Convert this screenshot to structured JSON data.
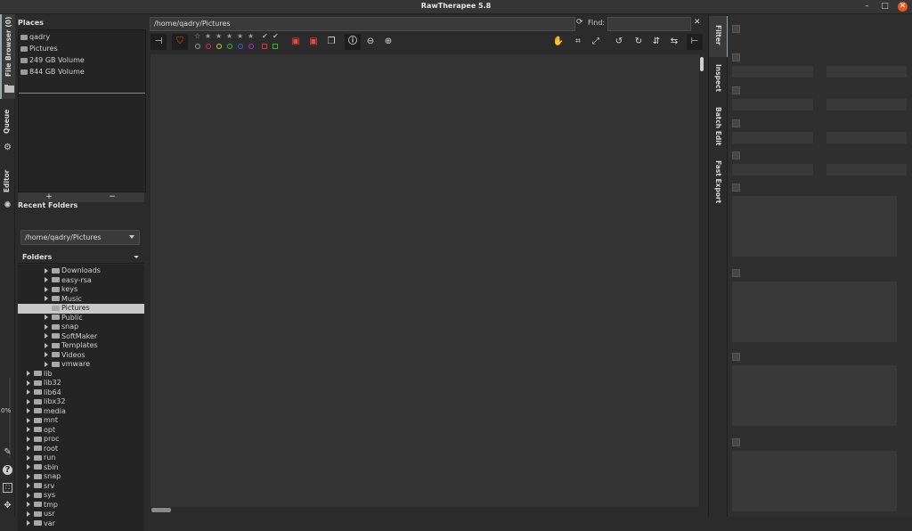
{
  "window": {
    "title": "RawTherapee 5.8",
    "minimize": "–",
    "maximize": "□",
    "close": "✕"
  },
  "left_tabs": [
    {
      "label": "File Browser (0)"
    },
    {
      "label": "Queue"
    },
    {
      "label": "Editor"
    }
  ],
  "progress": {
    "label": "0%"
  },
  "places": {
    "header": "Places",
    "items": [
      {
        "label": "qadry"
      },
      {
        "label": "Pictures"
      },
      {
        "label": "249 GB Volume"
      },
      {
        "label": "844 GB Volume"
      }
    ],
    "add": "+",
    "remove": "−"
  },
  "recent": {
    "header": "Recent Folders",
    "value": "/home/qadry/Pictures"
  },
  "folders": {
    "header": "Folders",
    "rows": [
      {
        "label": "Downloads",
        "indent": 3,
        "expand": true
      },
      {
        "label": "easy-rsa",
        "indent": 3,
        "expand": true
      },
      {
        "label": "keys",
        "indent": 3,
        "expand": true
      },
      {
        "label": "Music",
        "indent": 3,
        "expand": true
      },
      {
        "label": "Pictures",
        "indent": 3,
        "expand": false,
        "selected": true
      },
      {
        "label": "Public",
        "indent": 3,
        "expand": true
      },
      {
        "label": "snap",
        "indent": 3,
        "expand": true
      },
      {
        "label": "SoftMaker",
        "indent": 3,
        "expand": true
      },
      {
        "label": "Templates",
        "indent": 3,
        "expand": true
      },
      {
        "label": "Videos",
        "indent": 3,
        "expand": true
      },
      {
        "label": "vmware",
        "indent": 3,
        "expand": true
      },
      {
        "label": "lib",
        "indent": 1,
        "expand": true
      },
      {
        "label": "lib32",
        "indent": 1,
        "expand": true
      },
      {
        "label": "lib64",
        "indent": 1,
        "expand": true
      },
      {
        "label": "libx32",
        "indent": 1,
        "expand": true
      },
      {
        "label": "media",
        "indent": 1,
        "expand": true
      },
      {
        "label": "mnt",
        "indent": 1,
        "expand": true
      },
      {
        "label": "opt",
        "indent": 1,
        "expand": true
      },
      {
        "label": "proc",
        "indent": 1,
        "expand": true
      },
      {
        "label": "root",
        "indent": 1,
        "expand": true
      },
      {
        "label": "run",
        "indent": 1,
        "expand": true
      },
      {
        "label": "sbin",
        "indent": 1,
        "expand": true
      },
      {
        "label": "snap",
        "indent": 1,
        "expand": true
      },
      {
        "label": "srv",
        "indent": 1,
        "expand": true
      },
      {
        "label": "sys",
        "indent": 1,
        "expand": true
      },
      {
        "label": "tmp",
        "indent": 1,
        "expand": true
      },
      {
        "label": "usr",
        "indent": 1,
        "expand": true
      },
      {
        "label": "var",
        "indent": 1,
        "expand": true
      }
    ]
  },
  "browser": {
    "path": "/home/qadry/Pictures",
    "find_label": "Find:",
    "find_value": ""
  },
  "right_tabs": [
    {
      "label": "Filter"
    },
    {
      "label": "Inspect"
    },
    {
      "label": "Batch Edit"
    },
    {
      "label": "Fast Export"
    }
  ],
  "colors": {
    "accent": "#e95420",
    "selection": "#c8c8c8",
    "bg": "#2b2b2b"
  }
}
